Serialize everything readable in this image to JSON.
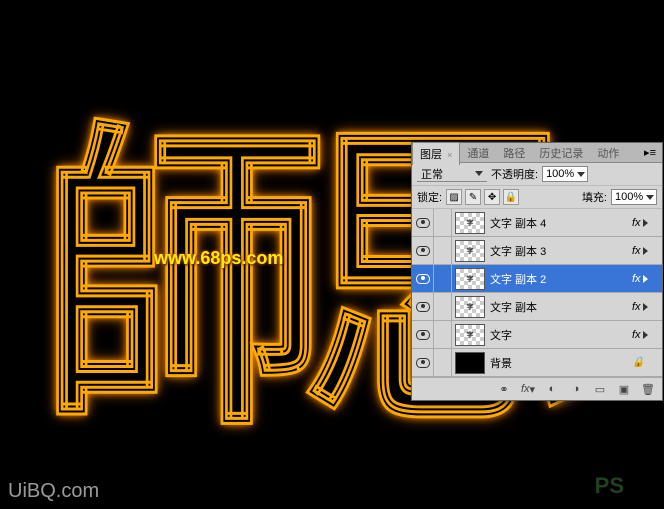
{
  "artwork": {
    "glow_text": "師思"
  },
  "watermark": {
    "url": "www.68ps.com",
    "ps": "PS",
    "uibq": "UiBQ.com"
  },
  "panel": {
    "tabs": {
      "t0": "图层",
      "t1": "通道",
      "t2": "路径",
      "t3": "历史记录",
      "t4": "动作"
    },
    "blend_mode": "正常",
    "opacity_label": "不透明度:",
    "opacity_value": "100%",
    "lock_label": "锁定:",
    "fill_label": "填充:",
    "fill_value": "100%",
    "layers": [
      {
        "name": "文字 副本 4",
        "selected": false,
        "fx": true,
        "thumb": "checker"
      },
      {
        "name": "文字 副本 3",
        "selected": false,
        "fx": true,
        "thumb": "checker"
      },
      {
        "name": "文字 副本 2",
        "selected": true,
        "fx": true,
        "thumb": "checker"
      },
      {
        "name": "文字 副本",
        "selected": false,
        "fx": true,
        "thumb": "checker"
      },
      {
        "name": "文字",
        "selected": false,
        "fx": true,
        "thumb": "checker"
      },
      {
        "name": "背景",
        "selected": false,
        "fx": false,
        "thumb": "black"
      }
    ],
    "fx_label": "fx"
  }
}
